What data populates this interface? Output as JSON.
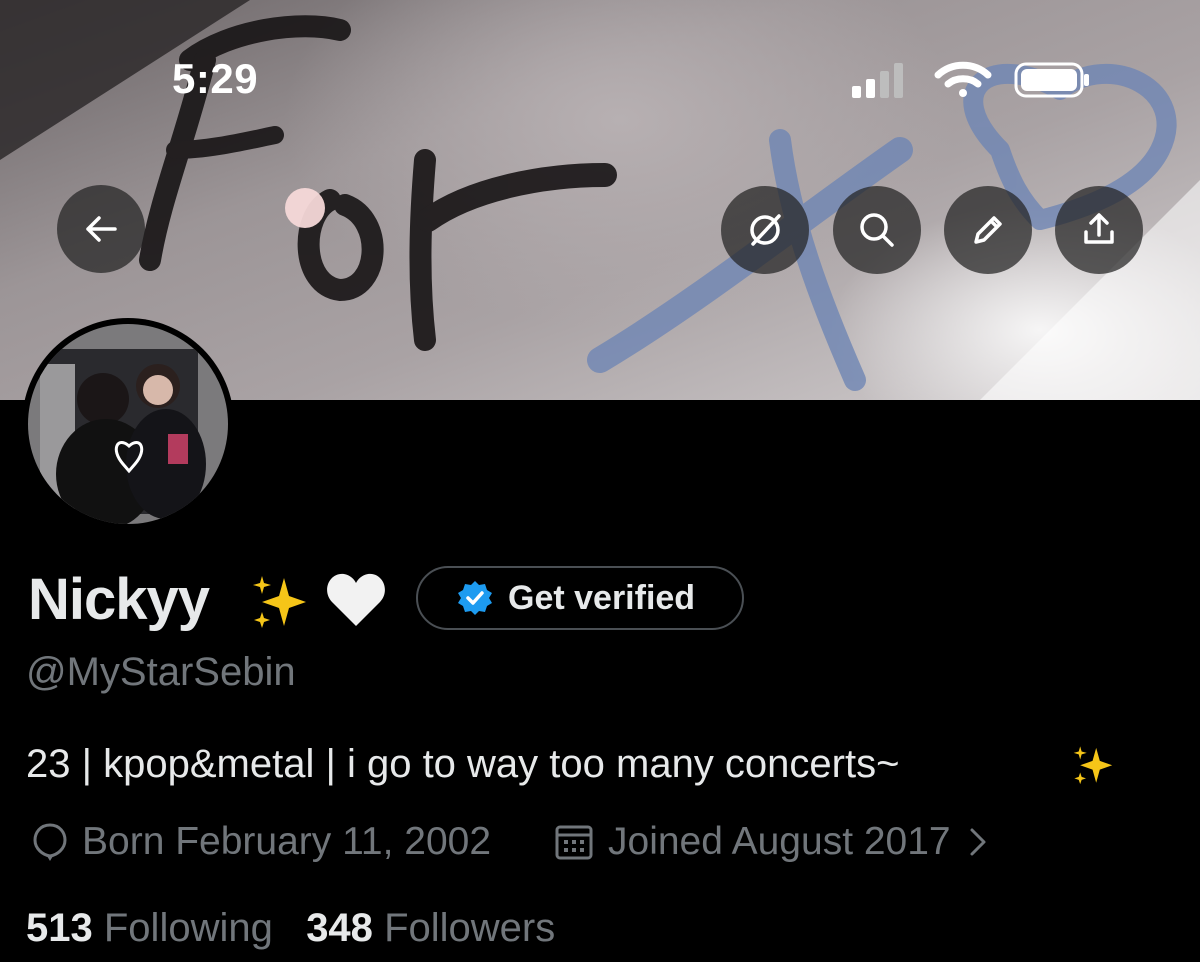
{
  "status_bar": {
    "time": "5:29"
  },
  "header": {
    "back_icon": "arrow-left-icon",
    "actions": [
      "mute-icon",
      "search-icon",
      "pencil-icon",
      "share-icon"
    ]
  },
  "profile": {
    "display_name": "Nickyy",
    "name_emojis": [
      "✨",
      "🤍"
    ],
    "verify_button_label": "Get verified",
    "handle": "@MyStarSebin",
    "bio": "23 | kpop&metal | i go to way too many concerts~",
    "bio_emoji": "✨",
    "birth": "Born February 11, 2002",
    "joined": "Joined August 2017",
    "following_count": "513",
    "following_label": "Following",
    "followers_count": "348",
    "followers_label": "Followers"
  },
  "colors": {
    "background": "#000000",
    "primary_text": "#e7e9ea",
    "secondary_text": "#71767b",
    "verified_blue": "#1d9bf0"
  }
}
